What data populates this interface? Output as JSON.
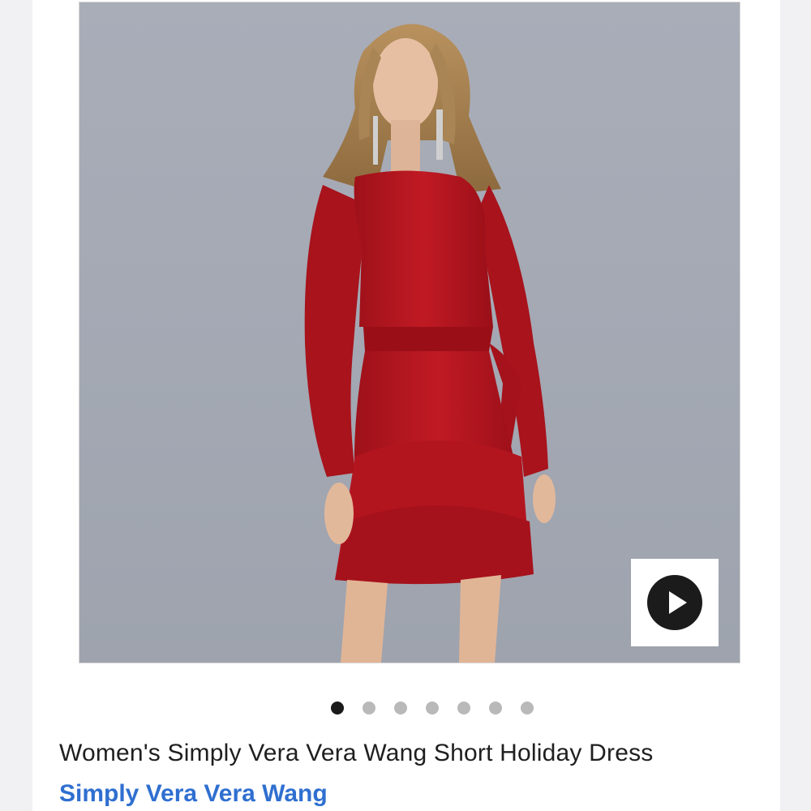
{
  "product": {
    "title": "Women's Simply Vera Vera Wang Short Holiday Dress",
    "brand": "Simply Vera Vera Wang",
    "image_alt": "Model wearing red long-sleeve tiered holiday dress with tie waist",
    "play_icon": "play-icon"
  },
  "carousel": {
    "total_slides": 7,
    "active_index": 0
  },
  "colors": {
    "background": "#f1f1f3",
    "brand_link": "#2f6fd0",
    "dress": "#b2141e",
    "dot_active": "#1a1a1a",
    "dot_inactive": "#b9b9b9"
  }
}
